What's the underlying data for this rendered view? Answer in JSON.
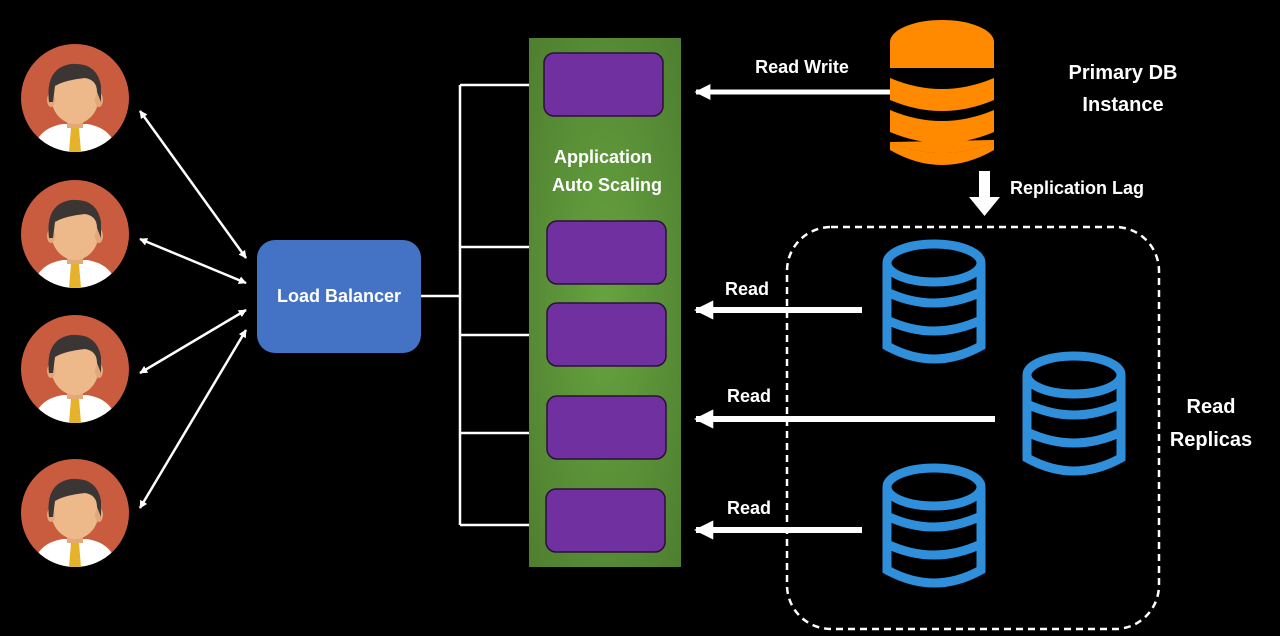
{
  "diagram": {
    "users": [
      {
        "id": "user-1"
      },
      {
        "id": "user-2"
      },
      {
        "id": "user-3"
      },
      {
        "id": "user-4"
      }
    ],
    "load_balancer": {
      "label": "Load Balancer"
    },
    "app_group": {
      "label_line1": "Application",
      "label_line2": "Auto Scaling",
      "instance_count": 5
    },
    "primary_db": {
      "label_line1": "Primary DB",
      "label_line2": "Instance"
    },
    "edges": {
      "read_write": "Read Write",
      "replication": "Replication Lag",
      "read": [
        "Read",
        "Read",
        "Read"
      ]
    },
    "replicas": {
      "label_line1": "Read",
      "label_line2": "Replicas",
      "count": 3
    },
    "colors": {
      "background": "#000000",
      "user_circle": "#c95b3f",
      "skin": "#eeb98a",
      "hair": "#3b3633",
      "shirt": "#ffffff",
      "tie": "#e6b22a",
      "load_balancer": "#4472c4",
      "app_group": "#5b9338",
      "instance": "#7030a0",
      "primary_db": "#ff8a00",
      "replica_db": "#2f8fdb"
    }
  }
}
